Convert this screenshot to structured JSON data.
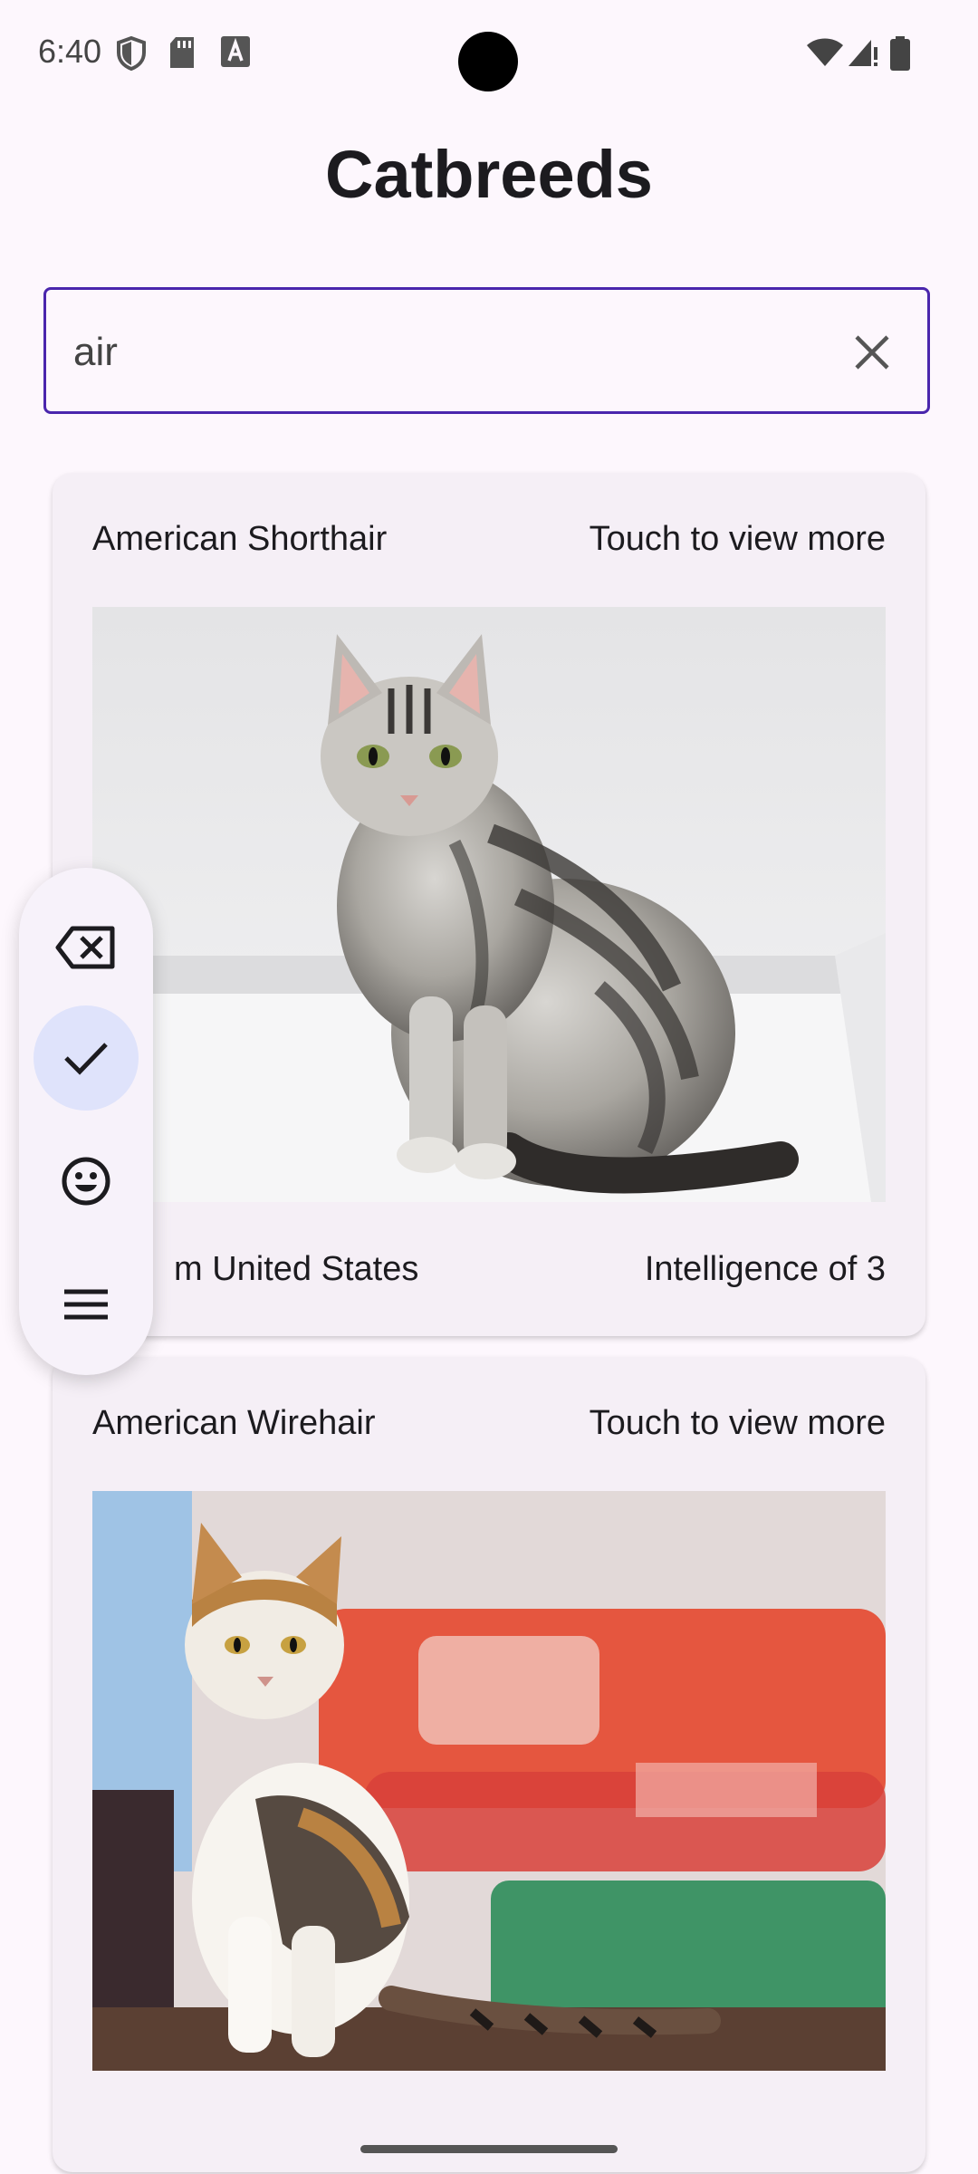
{
  "status": {
    "time": "6:40",
    "icons": [
      "shield-icon",
      "sd-card-icon",
      "font-a-icon",
      "wifi-icon",
      "signal-icon",
      "battery-icon"
    ]
  },
  "app": {
    "title": "Catbreeds"
  },
  "search": {
    "value": "air",
    "clear_icon": "close-icon"
  },
  "cards": [
    {
      "name": "American Shorthair",
      "cta": "Touch to view more",
      "origin": "m United States",
      "intelligence": "Intelligence of 3",
      "image": "silver tabby cat sitting"
    },
    {
      "name": "American Wirehair",
      "cta": "Touch to view more",
      "image": "calico cat sitting on table"
    }
  ],
  "keyboard_toolbar": {
    "buttons": [
      "backspace-icon",
      "check-icon",
      "emoji-icon",
      "menu-icon"
    ],
    "active": "check-icon"
  },
  "colors": {
    "background": "#fdf7fd",
    "search_border": "#4a26ad",
    "card_bg": "#f5eff6",
    "active_button": "#dfe3fb"
  }
}
